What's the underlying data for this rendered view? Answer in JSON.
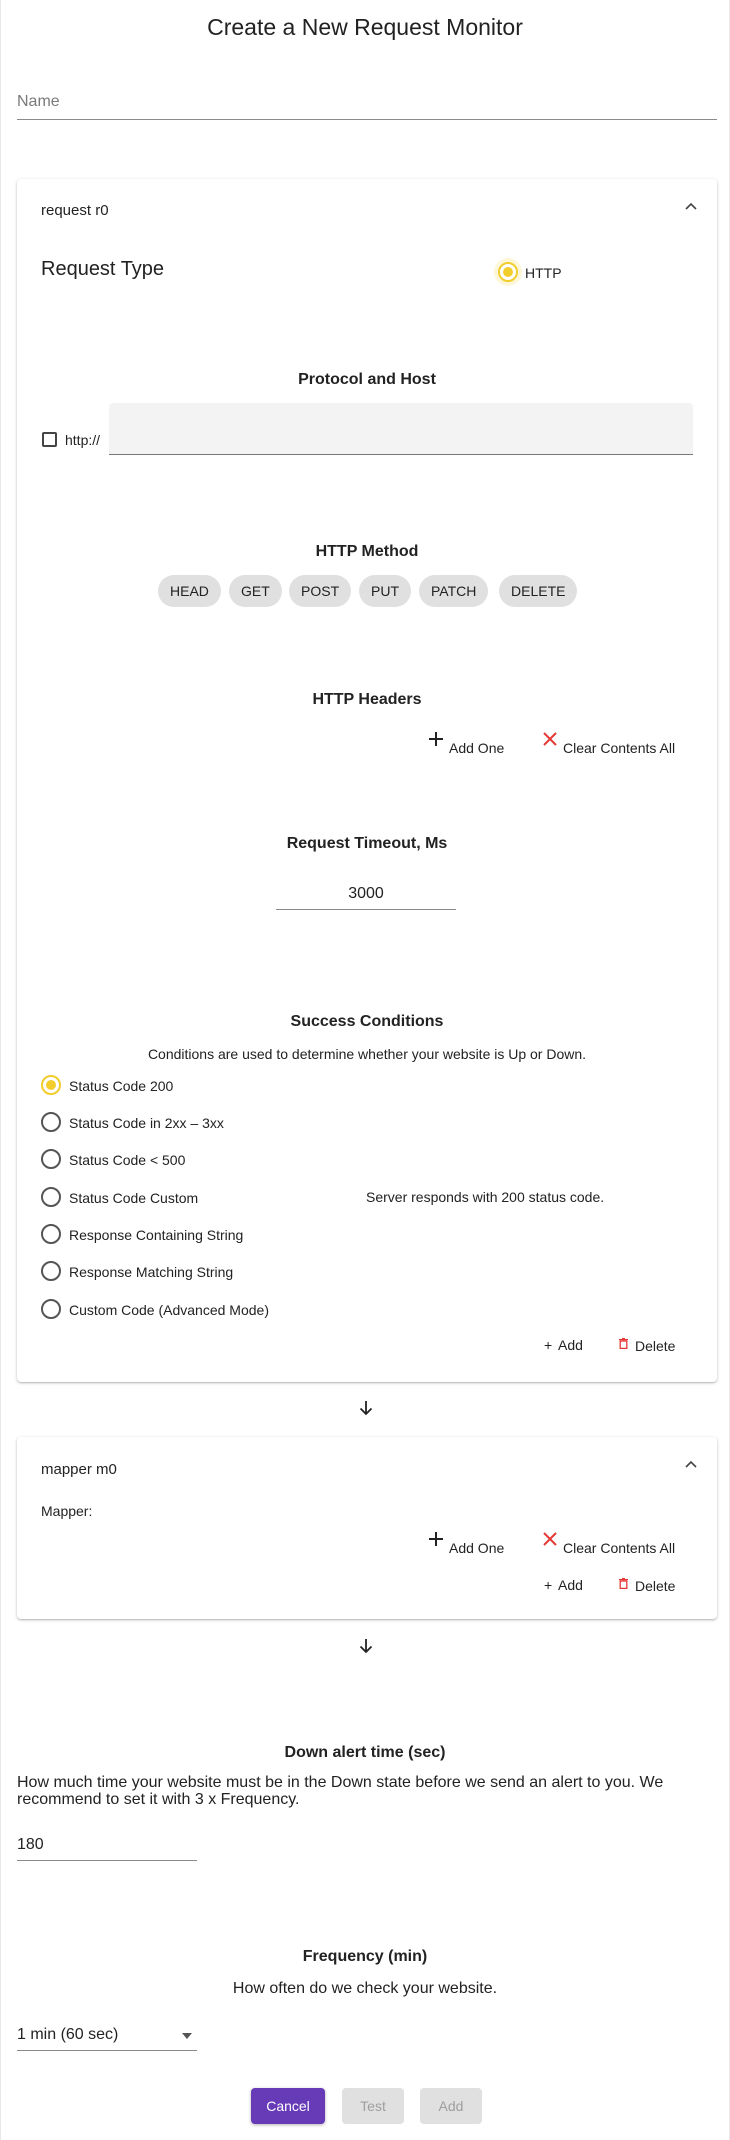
{
  "page": {
    "title": "Create a New Request Monitor"
  },
  "name_field": {
    "placeholder": "Name"
  },
  "request_card": {
    "header": "request r0",
    "request_type": {
      "label": "Request Type",
      "options": [
        {
          "label": "HTTP",
          "selected": true
        }
      ]
    },
    "protocol_host": {
      "heading": "Protocol and Host",
      "https_checkbox_label": "http://",
      "https_checked": false,
      "host_value": ""
    },
    "http_method": {
      "heading": "HTTP Method",
      "methods": [
        "HEAD",
        "GET",
        "POST",
        "PUT",
        "PATCH",
        "DELETE"
      ]
    },
    "http_headers": {
      "heading": "HTTP Headers",
      "add_label": "Add One",
      "clear_label": "Clear Contents All"
    },
    "timeout": {
      "heading": "Request Timeout, Ms",
      "value": "3000"
    },
    "success": {
      "heading": "Success Conditions",
      "description": "Conditions are used to determine whether your website is Up or Down.",
      "options": [
        {
          "label": "Status Code 200",
          "selected": true
        },
        {
          "label": "Status Code in 2xx – 3xx",
          "selected": false
        },
        {
          "label": "Status Code < 500",
          "selected": false
        },
        {
          "label": "Status Code Custom",
          "selected": false
        },
        {
          "label": "Response Containing String",
          "selected": false
        },
        {
          "label": "Response Matching String",
          "selected": false
        },
        {
          "label": "Custom Code (Advanced Mode)",
          "selected": false
        }
      ],
      "explanation": "Server responds with 200 status code."
    },
    "add_label": "Add",
    "delete_label": "Delete"
  },
  "mapper_card": {
    "header": "mapper m0",
    "mapper_label": "Mapper:",
    "add_one_label": "Add One",
    "clear_label": "Clear Contents All",
    "add_label": "Add",
    "delete_label": "Delete"
  },
  "down_alert": {
    "heading": "Down alert time (sec)",
    "description": "How much time your website must be in the Down state before we send an alert to you. We recommend to set it with 3 x Frequency.",
    "value": "180"
  },
  "frequency": {
    "heading": "Frequency (min)",
    "description": "How often do we check your website.",
    "selected": "1 min (60 sec)"
  },
  "actions": {
    "cancel": "Cancel",
    "test": "Test",
    "add": "Add"
  },
  "colors": {
    "accent_yellow": "#f2cd2c",
    "primary_purple": "#673ab7",
    "delete_red": "#e53935"
  }
}
